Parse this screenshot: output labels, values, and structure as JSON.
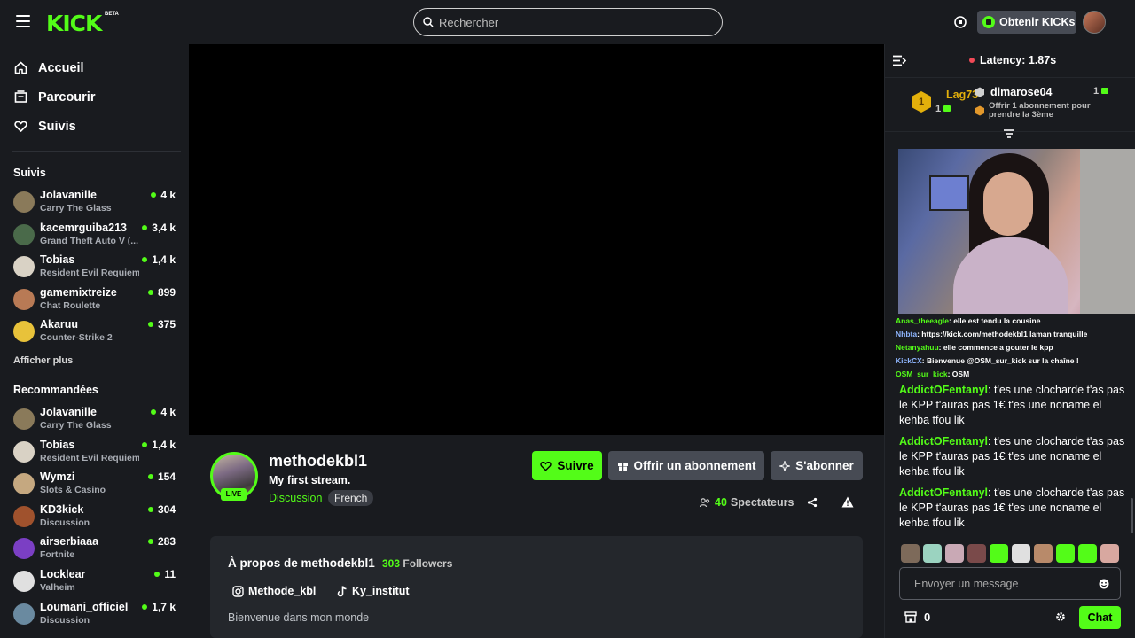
{
  "header": {
    "logo_text": "KICK",
    "logo_badge": "BETA",
    "search_placeholder": "Rechercher",
    "kicks_button": "Obtenir KICKs"
  },
  "sidebar": {
    "nav": [
      {
        "label": "Accueil",
        "icon": "home-icon"
      },
      {
        "label": "Parcourir",
        "icon": "browse-icon"
      },
      {
        "label": "Suivis",
        "icon": "heart-icon"
      }
    ],
    "followed_title": "Suivis",
    "followed": [
      {
        "name": "Jolavanille",
        "category": "Carry The Glass",
        "viewers": "4 k",
        "color": "#8a7a5a"
      },
      {
        "name": "kacemrguiba213",
        "category": "Grand Theft Auto V (...",
        "viewers": "3,4 k",
        "color": "#4a6a4a"
      },
      {
        "name": "Tobias",
        "category": "Resident Evil Requiem",
        "viewers": "1,4 k",
        "color": "#d9d2c5"
      },
      {
        "name": "gamemixtreize",
        "category": "Chat Roulette",
        "viewers": "899",
        "color": "#b87a55"
      },
      {
        "name": "Akaruu",
        "category": "Counter-Strike 2",
        "viewers": "375",
        "color": "#e8c23a"
      }
    ],
    "show_more": "Afficher plus",
    "recommended_title": "Recommandées",
    "recommended": [
      {
        "name": "Jolavanille",
        "category": "Carry The Glass",
        "viewers": "4 k",
        "color": "#8a7a5a"
      },
      {
        "name": "Tobias",
        "category": "Resident Evil Requiem",
        "viewers": "1,4 k",
        "color": "#d9d2c5"
      },
      {
        "name": "Wymzi",
        "category": "Slots & Casino",
        "viewers": "154",
        "color": "#c5a880"
      },
      {
        "name": "KD3kick",
        "category": "Discussion",
        "viewers": "304",
        "color": "#a0522d"
      },
      {
        "name": "airserbiaaa",
        "category": "Fortnite",
        "viewers": "283",
        "color": "#7b3fc4"
      },
      {
        "name": "Locklear",
        "category": "Valheim",
        "viewers": "11",
        "color": "#e0e0e0"
      },
      {
        "name": "Loumani_officiel",
        "category": "Discussion",
        "viewers": "1,7 k",
        "color": "#6a8aa0"
      }
    ]
  },
  "stream": {
    "live_label": "LIVE",
    "streamer": "methodekbl1",
    "title": "My first stream.",
    "category": "Discussion",
    "language": "French",
    "follow_button": "Suivre",
    "gift_button": "Offrir un abonnement",
    "subscribe_button": "S'abonner",
    "viewers_count": "40",
    "viewers_label": "Spectateurs"
  },
  "about": {
    "title": "À propos de methodekbl1",
    "followers_count": "303",
    "followers_label": "Followers",
    "instagram": "Methode_kbl",
    "tiktok": "Ky_institut",
    "description": "Bienvenue dans mon monde"
  },
  "chat": {
    "latency": "Latency: 1.87s",
    "leaderboard": {
      "rank": "1",
      "user1": "Lag73",
      "user1_count": "1",
      "user2": "dimarose04",
      "user2_count": "1",
      "offer_text": "Offrir 1 abonnement pour prendre la 3ème"
    },
    "overlay_lines": [
      {
        "user": "Anas_theeagle",
        "text": "elle est tendu la cousine"
      },
      {
        "user": "Nhbta",
        "text": "https://kick.com/methodekbl1 laman tranquille"
      },
      {
        "user": "Netanyahuu",
        "text": "elle commence a gouter le kpp"
      },
      {
        "user": "KickCX",
        "text": "Bienvenue @OSM_sur_kick sur la chaîne !"
      },
      {
        "user": "OSM_sur_kick",
        "text": "OSM"
      }
    ],
    "messages": [
      {
        "user": "AddictOFentanyl",
        "text": "t'es une clocharde t'as pas le KPP t'auras pas 1€ t'es une noname el kehba tfou lik"
      },
      {
        "user": "AddictOFentanyl",
        "text": "t'es une clocharde t'as pas le KPP t'auras pas 1€ t'es une noname el kehba tfou lik"
      },
      {
        "user": "AddictOFentanyl",
        "text": "t'es une clocharde t'as pas le KPP t'auras pas 1€ t'es une noname el kehba tfou lik"
      }
    ],
    "input_placeholder": "Envoyer un message",
    "points": "0",
    "send_button": "Chat"
  }
}
